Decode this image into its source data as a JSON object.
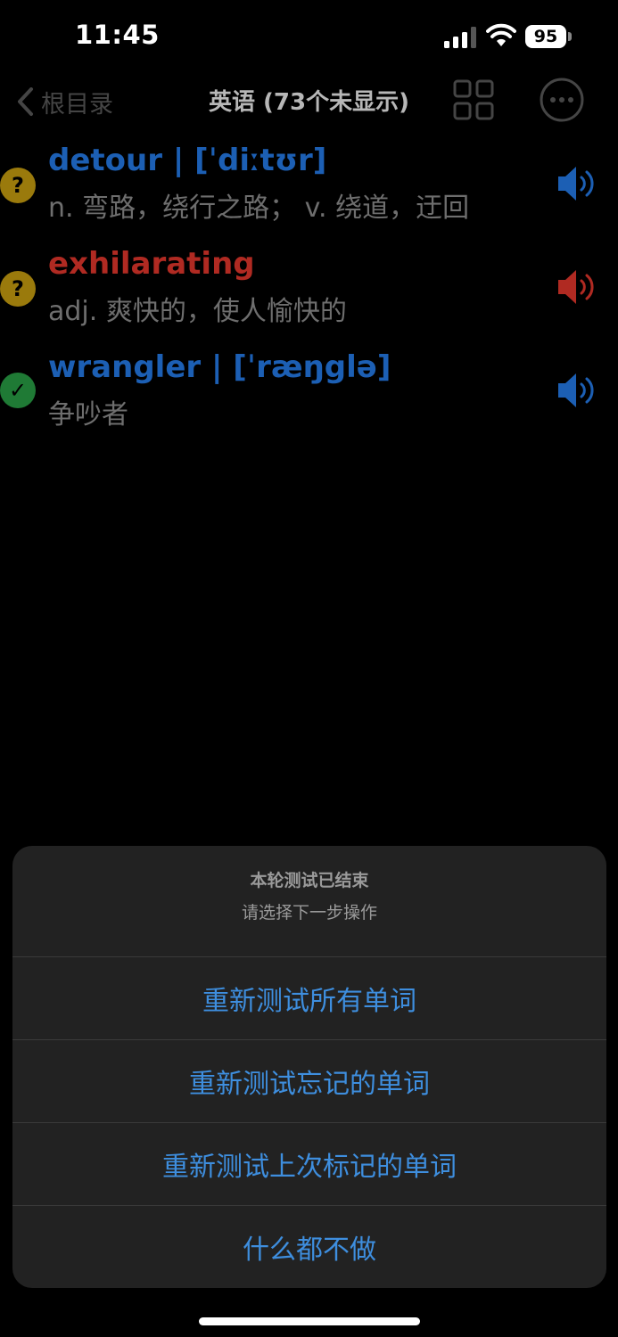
{
  "status_bar": {
    "time": "11:45",
    "battery": "95",
    "icons": [
      "signal-icon",
      "wifi-icon",
      "battery-icon"
    ]
  },
  "nav": {
    "back_label": "根目录",
    "title": "英语 (73个未显示)",
    "icons": [
      "chevron-left-icon",
      "grid-icon",
      "more-icon"
    ]
  },
  "words": [
    {
      "status": "?",
      "status_type": "unknown",
      "headword": "detour | [ˈdiːtʊr]",
      "definition": "n. 弯路，绕行之路；  v. 绕道，迂回",
      "color": "#1c5fb4",
      "speaker_color": "#1c5fb4"
    },
    {
      "status": "?",
      "status_type": "unknown",
      "headword": "exhilarating",
      "definition": "adj. 爽快的，使人愉快的",
      "color": "#b02a22",
      "speaker_color": "#b02a22"
    },
    {
      "status": "✓",
      "status_type": "known",
      "headword": "wrangler | [ˈræŋglə]",
      "definition": "争吵者",
      "color": "#1c5fb4",
      "speaker_color": "#1c5fb4"
    }
  ],
  "action_sheet": {
    "title": "本轮测试已结束",
    "subtitle": "请选择下一步操作",
    "actions": [
      "重新测试所有单词",
      "重新测试忘记的单词",
      "重新测试上次标记的单词",
      "什么都不做"
    ],
    "action_color": "#3e8ede"
  }
}
